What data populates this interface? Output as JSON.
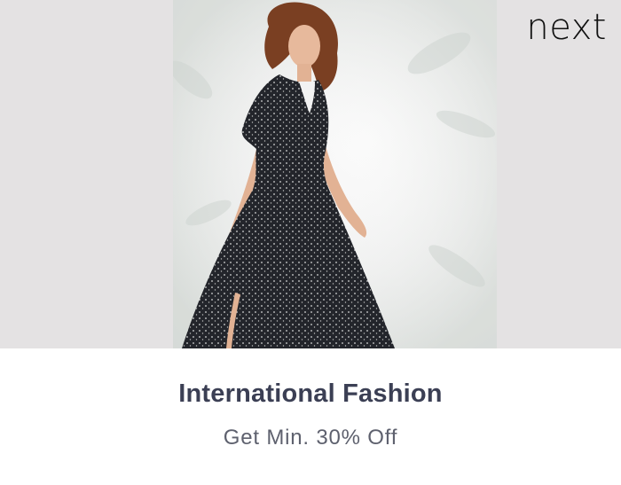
{
  "banner": {
    "brand_logo_text": "next",
    "headline": "International Fashion",
    "offer_text": "Get Min. 30% Off",
    "colors": {
      "headline": "#3b3f54",
      "offer": "#5e616e",
      "hero_background": "#e4e2e3",
      "logo": "#111111"
    },
    "image_subject": "model in black polka-dot wrap maxi dress"
  }
}
